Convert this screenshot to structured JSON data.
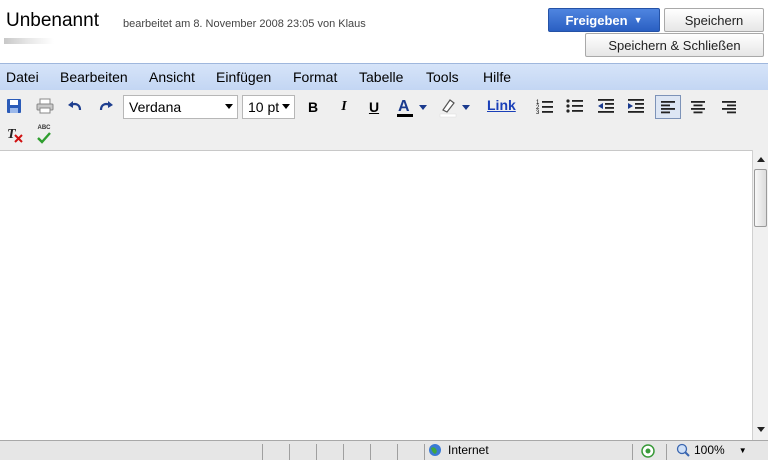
{
  "header": {
    "title": "Unbenannt",
    "edit_info": "bearbeitet am 8. November 2008 23:05 von Klaus",
    "share_label": "Freigeben",
    "save_label": "Speichern",
    "save_close_label": "Speichern & Schließen"
  },
  "menu": [
    "Datei",
    "Bearbeiten",
    "Ansicht",
    "Einfügen",
    "Format",
    "Tabelle",
    "Tools",
    "Hilfe"
  ],
  "toolbar": {
    "font": "Verdana",
    "size": "10 pt",
    "bold": "B",
    "italic": "I",
    "underline": "U",
    "link": "Link",
    "spell_label": "ABC"
  },
  "icons": [
    "save-icon",
    "print-icon",
    "undo-icon",
    "redo-icon",
    "text-color-icon",
    "highlight-icon",
    "numbered-list-icon",
    "bullet-list-icon",
    "outdent-icon",
    "indent-icon",
    "align-left-icon",
    "align-center-icon",
    "align-right-icon",
    "remove-format-icon",
    "spellcheck-icon",
    "internet-zone-icon",
    "zoom-icon"
  ],
  "statusbar": {
    "zone": "Internet",
    "zoom": "100%"
  },
  "colors": {
    "accent": "#3a70d6",
    "menubar": "#c9daf5",
    "text_color_underline": "#000000"
  }
}
